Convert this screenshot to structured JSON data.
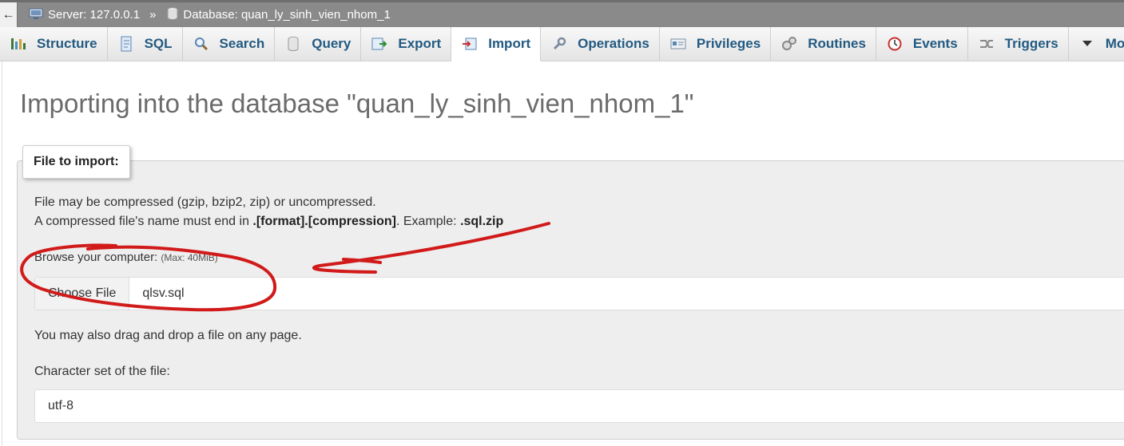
{
  "breadcrumb": {
    "back": "←",
    "server": "Server: 127.0.0.1",
    "separator": "»",
    "database": "Database: quan_ly_sinh_vien_nhom_1"
  },
  "tabs": [
    {
      "label": "Structure",
      "icon": "structure-icon"
    },
    {
      "label": "SQL",
      "icon": "sql-icon"
    },
    {
      "label": "Search",
      "icon": "search-icon"
    },
    {
      "label": "Query",
      "icon": "query-icon"
    },
    {
      "label": "Export",
      "icon": "export-icon"
    },
    {
      "label": "Import",
      "icon": "import-icon",
      "active": true
    },
    {
      "label": "Operations",
      "icon": "wrench-icon"
    },
    {
      "label": "Privileges",
      "icon": "privileges-icon"
    },
    {
      "label": "Routines",
      "icon": "routines-icon"
    },
    {
      "label": "Events",
      "icon": "clock-icon"
    },
    {
      "label": "Triggers",
      "icon": "triggers-icon"
    },
    {
      "label": "More",
      "icon": "chevron-down-icon"
    }
  ],
  "main": {
    "title": "Importing into the database \"quan_ly_sinh_vien_nhom_1\"",
    "legend": "File to import:",
    "info_line1": "File may be compressed (gzip, bzip2, zip) or uncompressed.",
    "info_line2_prefix": "A compressed file's name must end in ",
    "info_line2_format": ".[format].[compression]",
    "info_line2_mid": ". Example: ",
    "info_line2_example": ".sql.zip",
    "browse_label": "Browse your computer:",
    "browse_max": "(Max: 40MiB)",
    "choose_file_label": "Choose File",
    "file_name": "qlsv.sql",
    "drag_text": "You may also drag and drop a file on any page.",
    "charset_label": "Character set of the file:",
    "charset_value": "utf-8"
  },
  "colors": {
    "tab_text": "#235a81",
    "annotation": "#d11a1a"
  }
}
